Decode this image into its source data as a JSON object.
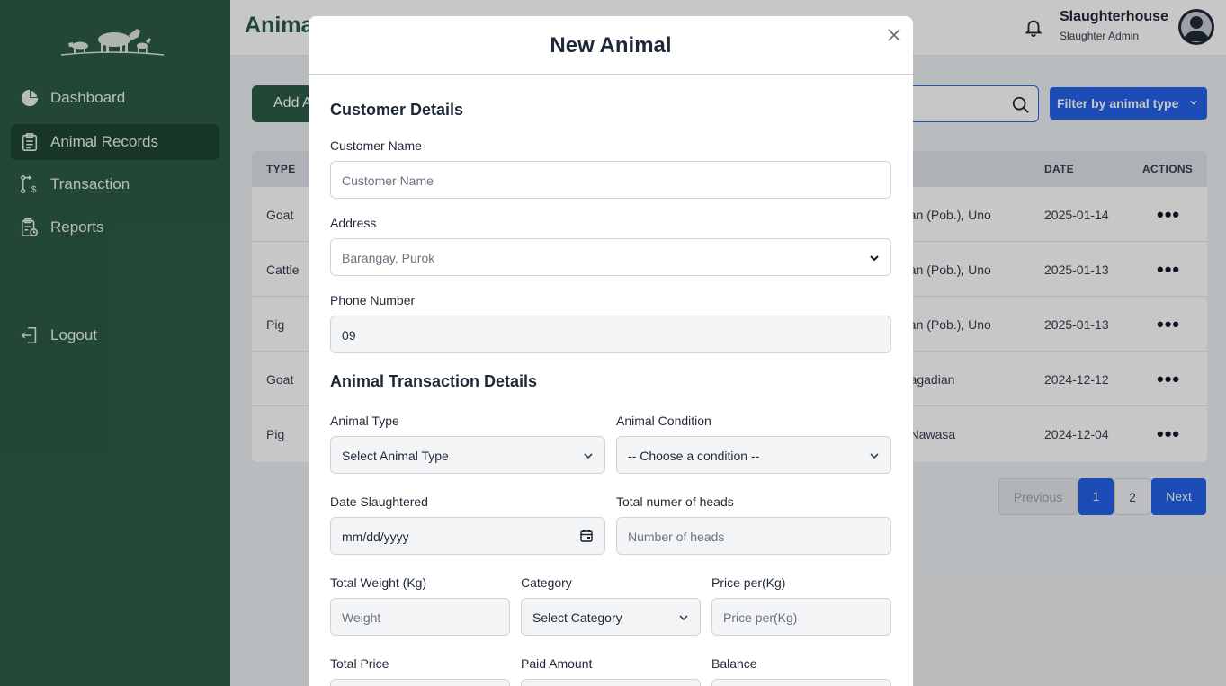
{
  "sidebar": {
    "items": [
      {
        "label": "Dashboard",
        "icon": "pie-chart-icon"
      },
      {
        "label": "Animal Records",
        "icon": "clipboard-icon"
      },
      {
        "label": "Transaction",
        "icon": "transaction-icon"
      },
      {
        "label": "Reports",
        "icon": "report-icon"
      }
    ],
    "logout": {
      "label": "Logout",
      "icon": "logout-icon"
    }
  },
  "header": {
    "title": "Animal Records",
    "user_name": "Slaughterhouse",
    "user_role": "Slaughter Admin"
  },
  "toolbar": {
    "add_label": "Add Animal",
    "filter_label": "Filter by animal type"
  },
  "table": {
    "columns": {
      "type": "TYPE",
      "date": "DATE",
      "actions": "ACTIONS"
    },
    "rows": [
      {
        "type": "Goat",
        "address": "asan (Pob.), Uno",
        "date": "2025-01-14"
      },
      {
        "type": "Cattle",
        "address": "asan (Pob.), Uno",
        "date": "2025-01-13"
      },
      {
        "type": "Pig",
        "address": "asan (Pob.), Uno",
        "date": "2025-01-13"
      },
      {
        "type": "Goat",
        "address": ", pagadian",
        "date": "2024-12-12"
      },
      {
        "type": "Pig",
        "address": "n, Nawasa",
        "date": "2024-12-04"
      }
    ],
    "actions_glyph": "•••"
  },
  "pagination": {
    "previous": "Previous",
    "pages": [
      "1",
      "2"
    ],
    "next": "Next"
  },
  "modal": {
    "title": "New Animal",
    "customer_section": "Customer Details",
    "customer_name": {
      "label": "Customer Name",
      "placeholder": "Customer Name"
    },
    "address": {
      "label": "Address",
      "placeholder": "Barangay, Purok"
    },
    "phone": {
      "label": "Phone Number",
      "value": "09"
    },
    "transaction_section": "Animal Transaction Details",
    "animal_type": {
      "label": "Animal Type",
      "value": "Select Animal Type"
    },
    "animal_condition": {
      "label": "Animal Condition",
      "value": "-- Choose a condition --"
    },
    "date_slaughtered": {
      "label": "Date Slaughtered",
      "value": "mm/dd/yyyy"
    },
    "total_heads": {
      "label": "Total numer of heads",
      "placeholder": "Number of heads"
    },
    "total_weight": {
      "label": "Total Weight (Kg)",
      "placeholder": "Weight"
    },
    "category": {
      "label": "Category",
      "value": "Select Category"
    },
    "price_per_kg": {
      "label": "Price per(Kg)",
      "placeholder": "Price per(Kg)"
    },
    "total_price": {
      "label": "Total Price"
    },
    "paid_amount": {
      "label": "Paid Amount"
    },
    "balance": {
      "label": "Balance"
    }
  },
  "colors": {
    "sidebar": "#2e5c46",
    "sidebar_active": "#1f4634",
    "primary_blue": "#2563eb"
  }
}
